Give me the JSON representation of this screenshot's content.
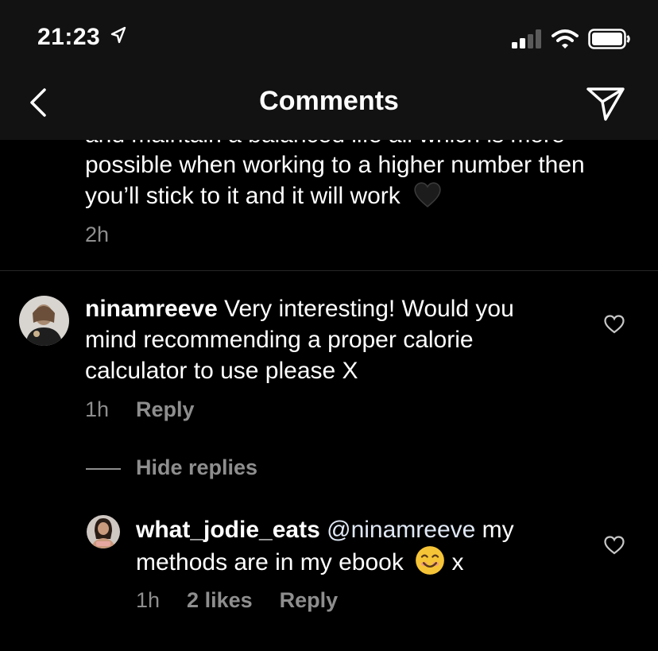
{
  "status": {
    "time": "21:23"
  },
  "header": {
    "title": "Comments"
  },
  "previous_comment": {
    "partial_line": "and maintain a balanced life all which is more",
    "line1": "possible when working to a higher number then",
    "line2": "you’ll stick to it and it will work",
    "emoji": "black-heart",
    "time": "2h"
  },
  "comment": {
    "username": "ninamreeve",
    "line1": "Very interesting! Would you",
    "line2": "mind recommending a proper calorie",
    "line3": "calculator to use please X",
    "time": "1h",
    "reply_label": "Reply"
  },
  "hide_replies_label": "Hide replies",
  "reply": {
    "username": "what_jodie_eats",
    "mention": "@ninamreeve",
    "line1_rest": "my",
    "line2": "methods are in my ebook",
    "emoji": "smiling-face",
    "line2_end": "x",
    "time": "1h",
    "likes": "2 likes",
    "reply_label": "Reply"
  }
}
